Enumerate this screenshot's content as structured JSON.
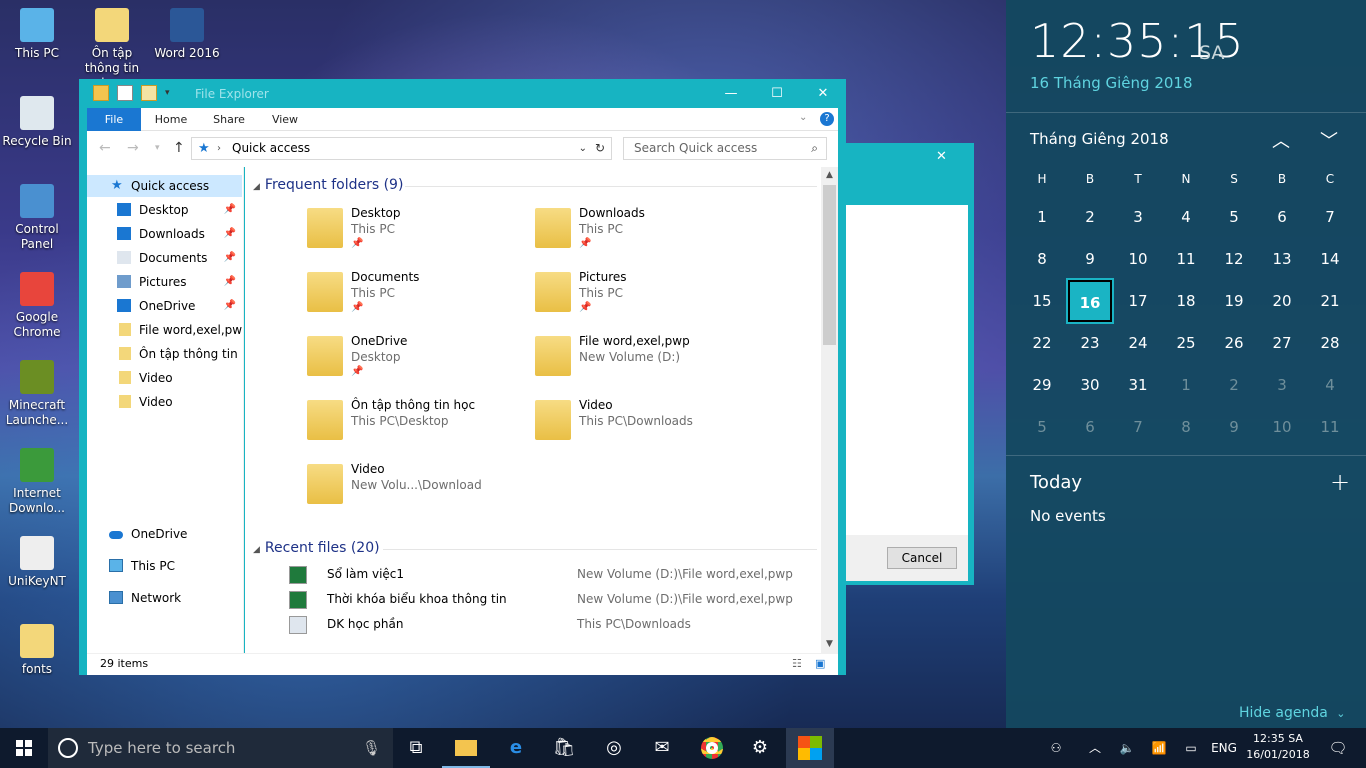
{
  "desktop": {
    "icons": [
      {
        "label": "This PC",
        "icon": "computer-icon"
      },
      {
        "label": "Ôn tập thông tin học",
        "icon": "folder-icon"
      },
      {
        "label": "Word 2016",
        "icon": "word-icon"
      },
      {
        "label": "Recycle Bin",
        "icon": "recycle-bin-icon"
      },
      {
        "label": "Control Panel",
        "icon": "control-panel-icon"
      },
      {
        "label": "Google Chrome",
        "icon": "chrome-icon"
      },
      {
        "label": "Minecraft Launche...",
        "icon": "minecraft-icon"
      },
      {
        "label": "Internet Downlo...",
        "icon": "idm-icon"
      },
      {
        "label": "UniKeyNT",
        "icon": "unikey-icon"
      },
      {
        "label": "fonts",
        "icon": "folder-icon"
      }
    ]
  },
  "explorer": {
    "title": "File Explorer",
    "window_buttons": {
      "minimize": "—",
      "maximize": "☐",
      "close": "✕"
    },
    "ribbon_tabs": [
      "File",
      "Home",
      "Share",
      "View"
    ],
    "address": "Quick access",
    "search_placeholder": "Search Quick access",
    "nav": {
      "quick_access": "Quick access",
      "pinned": [
        "Desktop",
        "Downloads",
        "Documents",
        "Pictures",
        "OneDrive"
      ],
      "recent_folders": [
        "File word,exel,pwp",
        "Ôn tập thông tin học",
        "Video",
        "Video"
      ],
      "onedrive": "OneDrive",
      "this_pc": "This PC",
      "network": "Network"
    },
    "frequent_header": "Frequent folders (9)",
    "frequent": [
      {
        "name": "Desktop",
        "path": "This PC",
        "pinned": true
      },
      {
        "name": "Downloads",
        "path": "This PC",
        "pinned": true
      },
      {
        "name": "Documents",
        "path": "This PC",
        "pinned": true
      },
      {
        "name": "Pictures",
        "path": "This PC",
        "pinned": true
      },
      {
        "name": "OneDrive",
        "path": "Desktop",
        "pinned": true
      },
      {
        "name": "File word,exel,pwp",
        "path": "New Volume (D:)",
        "pinned": false
      },
      {
        "name": "Ôn tập thông tin học",
        "path": "This PC\\Desktop",
        "pinned": false
      },
      {
        "name": "Video",
        "path": "This PC\\Downloads",
        "pinned": false
      },
      {
        "name": "Video",
        "path": "New Volu...\\Download",
        "pinned": false
      }
    ],
    "recent_header": "Recent files (20)",
    "recent": [
      {
        "name": "Sổ làm việc1",
        "path": "New Volume (D:)\\File word,exel,pwp",
        "icon": "excel-icon"
      },
      {
        "name": "Thời khóa biểu khoa thông tin",
        "path": "New Volume (D:)\\File word,exel,pwp",
        "icon": "excel-icon"
      },
      {
        "name": "DK học phần",
        "path": "This PC\\Downloads",
        "icon": "document-icon"
      }
    ],
    "status": "29 items"
  },
  "dialog": {
    "cancel_label": "Cancel",
    "close": "✕"
  },
  "flyout": {
    "time": "12:35:15",
    "ampm": "SA",
    "date_long": "16 Tháng Giêng 2018",
    "month_label": "Tháng Giêng 2018",
    "days_of_week": [
      "H",
      "B",
      "T",
      "N",
      "S",
      "B",
      "C"
    ],
    "days": [
      "1",
      "2",
      "3",
      "4",
      "5",
      "6",
      "7",
      "8",
      "9",
      "10",
      "11",
      "12",
      "13",
      "14",
      "15",
      "16",
      "17",
      "18",
      "19",
      "20",
      "21",
      "22",
      "23",
      "24",
      "25",
      "26",
      "27",
      "28",
      "29",
      "30",
      "31",
      "1",
      "2",
      "3",
      "4",
      "5",
      "6",
      "7",
      "8",
      "9",
      "10",
      "11"
    ],
    "current_month_count": 31,
    "today": "16",
    "agenda_title": "Today",
    "no_events": "No events",
    "hide_agenda": "Hide agenda"
  },
  "taskbar": {
    "search_placeholder": "Type here to search",
    "language": "ENG",
    "clock_time": "12:35 SA",
    "clock_date": "16/01/2018"
  },
  "colors": {
    "accent": "#17b4c2",
    "selected": "#cce8ff",
    "flyout": "#144860"
  }
}
